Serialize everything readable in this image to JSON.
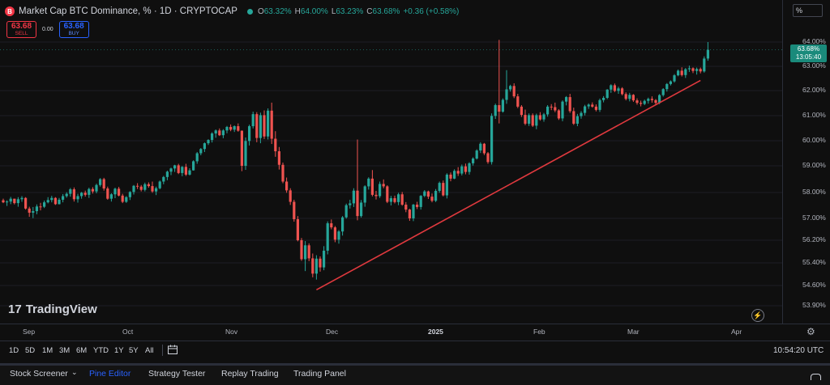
{
  "header": {
    "logo_letter": "B",
    "title": "Market Cap BTC Dominance, %",
    "interval": "1D",
    "source": "CRYPTOCAP",
    "ohlc": {
      "o_label": "O",
      "o": "63.32%",
      "h_label": "H",
      "h": "64.00%",
      "l_label": "L",
      "l": "63.23%",
      "c_label": "C",
      "c": "63.68%",
      "change": "+0.36 (+0.58%)"
    }
  },
  "trade": {
    "sell_price": "63.68",
    "sell_label": "SELL",
    "spread": "0.00",
    "buy_price": "63.68",
    "buy_label": "BUY"
  },
  "watermark": {
    "mark": "17",
    "text": "TradingView"
  },
  "scale_mode": "%",
  "price_ticks": [
    "64.00%",
    "63.00%",
    "62.00%",
    "61.00%",
    "60.00%",
    "59.00%",
    "58.00%",
    "57.00%",
    "56.20%",
    "55.40%",
    "54.60%",
    "53.90%"
  ],
  "last_price": {
    "value": "63.68%",
    "countdown": "13:05:40"
  },
  "time_labels": [
    "Sep",
    "Oct",
    "Nov",
    "Dec",
    "2025",
    "Feb",
    "Mar",
    "Apr"
  ],
  "toolbar": {
    "ranges": [
      "1D",
      "5D",
      "1M",
      "3M",
      "6M",
      "YTD",
      "1Y",
      "5Y",
      "All"
    ],
    "clock": "10:54:20 UTC"
  },
  "panels": {
    "tabs": [
      "Stock Screener",
      "Pine Editor",
      "Strategy Tester",
      "Replay Trading",
      "Trading Panel"
    ],
    "active": "Pine Editor"
  },
  "colors": {
    "up": "#26a69a",
    "down": "#ef5350",
    "trendline": "#e0393e",
    "accent": "#2962ff",
    "background": "#0f0f0f"
  },
  "chart_data": {
    "type": "candlestick",
    "symbol": "BTC.D",
    "interval": "1D",
    "ylim": [
      53.9,
      64.0
    ],
    "candles": [
      [
        57.7,
        57.76,
        57.59,
        57.62
      ],
      [
        57.62,
        57.7,
        57.48,
        57.65
      ],
      [
        57.65,
        57.83,
        57.55,
        57.76
      ],
      [
        57.76,
        57.76,
        57.54,
        57.59
      ],
      [
        57.59,
        57.82,
        57.45,
        57.74
      ],
      [
        57.74,
        57.86,
        57.64,
        57.79
      ],
      [
        57.79,
        57.82,
        57.34,
        57.38
      ],
      [
        57.38,
        57.45,
        57.06,
        57.22
      ],
      [
        57.22,
        57.44,
        57.01,
        57.28
      ],
      [
        57.28,
        57.54,
        57.16,
        57.46
      ],
      [
        57.46,
        57.6,
        57.31,
        57.45
      ],
      [
        57.45,
        57.69,
        57.4,
        57.62
      ],
      [
        57.62,
        57.82,
        57.58,
        57.71
      ],
      [
        57.71,
        57.87,
        57.62,
        57.79
      ],
      [
        57.79,
        57.82,
        57.52,
        57.55
      ],
      [
        57.55,
        57.79,
        57.54,
        57.72
      ],
      [
        57.72,
        57.94,
        57.62,
        57.86
      ],
      [
        57.86,
        58.01,
        57.8,
        57.95
      ],
      [
        57.95,
        58.17,
        57.84,
        58.12
      ],
      [
        58.12,
        58.19,
        57.65,
        57.74
      ],
      [
        57.74,
        57.95,
        57.61,
        57.86
      ],
      [
        57.86,
        58.02,
        57.76,
        57.99
      ],
      [
        57.99,
        58.07,
        57.84,
        57.91
      ],
      [
        57.91,
        58.18,
        57.79,
        58.13
      ],
      [
        58.13,
        58.2,
        57.96,
        58.04
      ],
      [
        58.04,
        58.33,
        57.97,
        58.28
      ],
      [
        58.28,
        58.54,
        58.22,
        58.5
      ],
      [
        58.5,
        58.55,
        58.07,
        58.15
      ],
      [
        58.15,
        58.22,
        57.72,
        57.76
      ],
      [
        57.76,
        57.97,
        57.65,
        57.93
      ],
      [
        57.93,
        58.18,
        57.78,
        58.14
      ],
      [
        58.14,
        58.21,
        57.85,
        57.88
      ],
      [
        57.88,
        57.95,
        57.59,
        57.64
      ],
      [
        57.64,
        57.86,
        57.6,
        57.82
      ],
      [
        57.82,
        58.05,
        57.71,
        58.02
      ],
      [
        58.02,
        58.28,
        57.92,
        58.25
      ],
      [
        58.25,
        58.35,
        58.13,
        58.22
      ],
      [
        58.22,
        58.28,
        58.04,
        58.1
      ],
      [
        58.1,
        58.37,
        58.04,
        58.31
      ],
      [
        58.31,
        58.38,
        58.18,
        58.24
      ],
      [
        58.24,
        58.41,
        57.99,
        58.04
      ],
      [
        58.04,
        58.22,
        57.9,
        58.16
      ],
      [
        58.16,
        58.45,
        58.12,
        58.41
      ],
      [
        58.41,
        58.62,
        58.31,
        58.58
      ],
      [
        58.58,
        58.82,
        58.46,
        58.78
      ],
      [
        58.78,
        58.93,
        58.65,
        58.9
      ],
      [
        58.9,
        59.04,
        58.77,
        59.02
      ],
      [
        59.02,
        59.08,
        58.69,
        58.73
      ],
      [
        58.73,
        58.99,
        58.61,
        58.96
      ],
      [
        58.96,
        59.08,
        58.62,
        58.67
      ],
      [
        58.67,
        58.91,
        58.64,
        58.83
      ],
      [
        58.83,
        59.22,
        58.82,
        59.18
      ],
      [
        59.18,
        59.55,
        59.08,
        59.5
      ],
      [
        59.5,
        59.71,
        59.42,
        59.67
      ],
      [
        59.67,
        59.93,
        59.55,
        59.9
      ],
      [
        59.9,
        60.06,
        59.83,
        60.03
      ],
      [
        60.03,
        60.34,
        59.93,
        60.29
      ],
      [
        60.29,
        60.45,
        60.12,
        60.41
      ],
      [
        60.41,
        60.49,
        60.19,
        60.22
      ],
      [
        60.22,
        60.46,
        60.1,
        60.41
      ],
      [
        60.41,
        60.59,
        60.3,
        60.55
      ],
      [
        60.55,
        60.65,
        60.38,
        60.44
      ],
      [
        60.44,
        60.61,
        60.35,
        60.58
      ],
      [
        60.58,
        60.69,
        60.36,
        60.4
      ],
      [
        60.4,
        60.41,
        58.8,
        59.0
      ],
      [
        59.0,
        60.13,
        58.85,
        59.99
      ],
      [
        59.99,
        60.64,
        59.81,
        60.58
      ],
      [
        60.58,
        61.16,
        60.49,
        61.06
      ],
      [
        61.06,
        61.14,
        59.94,
        60.11
      ],
      [
        60.11,
        61.12,
        59.9,
        61.02
      ],
      [
        61.02,
        61.21,
        60.07,
        60.17
      ],
      [
        60.17,
        61.29,
        60.05,
        61.2
      ],
      [
        61.2,
        61.52,
        59.87,
        60.08
      ],
      [
        60.08,
        60.38,
        59.36,
        59.58
      ],
      [
        59.58,
        59.75,
        58.86,
        59.04
      ],
      [
        59.04,
        59.13,
        58.35,
        58.41
      ],
      [
        58.41,
        58.56,
        57.99,
        58.08
      ],
      [
        58.08,
        58.16,
        57.52,
        57.64
      ],
      [
        57.64,
        57.72,
        56.88,
        56.97
      ],
      [
        56.97,
        57.09,
        56.16,
        56.2
      ],
      [
        56.2,
        56.28,
        55.47,
        55.53
      ],
      [
        55.53,
        56.17,
        55.11,
        56.02
      ],
      [
        56.02,
        56.09,
        55.46,
        55.56
      ],
      [
        55.56,
        55.73,
        54.89,
        55.02
      ],
      [
        55.02,
        55.67,
        54.81,
        55.55
      ],
      [
        55.55,
        55.63,
        55.09,
        55.24
      ],
      [
        55.24,
        55.99,
        55.14,
        55.83
      ],
      [
        55.83,
        56.89,
        55.7,
        56.82
      ],
      [
        56.82,
        56.96,
        56.6,
        56.67
      ],
      [
        56.67,
        56.72,
        56.13,
        56.22
      ],
      [
        56.22,
        56.57,
        56.08,
        56.52
      ],
      [
        56.52,
        57.09,
        56.37,
        57.04
      ],
      [
        57.04,
        57.57,
        56.99,
        57.51
      ],
      [
        57.51,
        57.72,
        57.38,
        57.58
      ],
      [
        57.58,
        58.16,
        57.44,
        58.07
      ],
      [
        58.07,
        60.05,
        56.93,
        57.09
      ],
      [
        57.09,
        57.71,
        57.03,
        57.61
      ],
      [
        57.61,
        58.27,
        57.45,
        58.23
      ],
      [
        58.23,
        58.57,
        58.11,
        58.52
      ],
      [
        58.52,
        58.84,
        57.85,
        57.91
      ],
      [
        57.91,
        58.06,
        57.73,
        57.86
      ],
      [
        57.86,
        58.41,
        57.79,
        58.32
      ],
      [
        58.32,
        58.49,
        58.16,
        58.23
      ],
      [
        58.23,
        58.27,
        57.59,
        57.64
      ],
      [
        57.64,
        57.87,
        57.5,
        57.78
      ],
      [
        57.78,
        57.88,
        57.58,
        57.63
      ],
      [
        57.63,
        57.99,
        57.51,
        57.93
      ],
      [
        57.93,
        58.02,
        57.49,
        57.53
      ],
      [
        57.53,
        57.63,
        57.24,
        57.34
      ],
      [
        57.34,
        57.37,
        56.91,
        57.0
      ],
      [
        57.0,
        57.56,
        56.9,
        57.53
      ],
      [
        57.53,
        57.64,
        57.36,
        57.44
      ],
      [
        57.44,
        57.9,
        57.34,
        57.87
      ],
      [
        57.87,
        58.09,
        57.82,
        58.04
      ],
      [
        58.04,
        58.07,
        57.75,
        57.84
      ],
      [
        57.84,
        57.96,
        57.62,
        57.68
      ],
      [
        57.68,
        58.13,
        57.63,
        58.06
      ],
      [
        58.06,
        58.41,
        57.99,
        58.36
      ],
      [
        58.36,
        58.45,
        57.85,
        57.89
      ],
      [
        57.89,
        58.72,
        57.77,
        58.67
      ],
      [
        58.67,
        58.75,
        58.42,
        58.52
      ],
      [
        58.52,
        58.87,
        58.5,
        58.81
      ],
      [
        58.81,
        58.95,
        58.62,
        58.71
      ],
      [
        58.71,
        59.05,
        58.64,
        58.98
      ],
      [
        58.98,
        59.09,
        58.68,
        58.77
      ],
      [
        58.77,
        59.14,
        58.67,
        59.1
      ],
      [
        59.1,
        59.34,
        59.01,
        59.29
      ],
      [
        59.29,
        59.66,
        59.25,
        59.61
      ],
      [
        59.61,
        59.94,
        59.51,
        59.88
      ],
      [
        59.88,
        59.91,
        59.43,
        59.5
      ],
      [
        59.5,
        59.55,
        59.08,
        59.15
      ],
      [
        59.15,
        61.09,
        59.05,
        60.99
      ],
      [
        60.99,
        61.48,
        60.87,
        61.42
      ],
      [
        61.42,
        64.09,
        60.69,
        61.16
      ],
      [
        61.16,
        61.69,
        61.12,
        61.63
      ],
      [
        61.63,
        62.84,
        61.47,
        62.05
      ],
      [
        62.05,
        62.24,
        61.96,
        62.19
      ],
      [
        62.19,
        62.3,
        61.7,
        61.77
      ],
      [
        61.77,
        61.87,
        61.3,
        61.36
      ],
      [
        61.36,
        61.42,
        60.95,
        61.03
      ],
      [
        61.03,
        61.24,
        60.62,
        60.68
      ],
      [
        60.68,
        61.09,
        60.59,
        61.02
      ],
      [
        61.02,
        61.09,
        60.55,
        60.6
      ],
      [
        60.6,
        61.08,
        60.46,
        61.02
      ],
      [
        61.02,
        61.14,
        60.8,
        60.85
      ],
      [
        60.85,
        61.11,
        60.76,
        61.05
      ],
      [
        61.05,
        61.42,
        60.96,
        61.36
      ],
      [
        61.36,
        61.46,
        61.22,
        61.34
      ],
      [
        61.34,
        61.52,
        61.14,
        61.21
      ],
      [
        61.21,
        61.26,
        60.83,
        60.89
      ],
      [
        60.89,
        61.61,
        60.78,
        61.56
      ],
      [
        61.56,
        61.78,
        61.41,
        61.74
      ],
      [
        61.74,
        61.87,
        61.11,
        61.18
      ],
      [
        61.18,
        61.32,
        60.63,
        60.68
      ],
      [
        60.68,
        61.07,
        60.58,
        60.98
      ],
      [
        60.98,
        61.18,
        60.88,
        61.11
      ],
      [
        61.11,
        61.43,
        61.01,
        61.37
      ],
      [
        61.37,
        61.49,
        61.27,
        61.44
      ],
      [
        61.44,
        61.53,
        61.32,
        61.36
      ],
      [
        61.36,
        61.45,
        61.17,
        61.23
      ],
      [
        61.23,
        61.68,
        61.15,
        61.62
      ],
      [
        61.62,
        61.78,
        61.53,
        61.71
      ],
      [
        61.71,
        62.06,
        61.66,
        62.04
      ],
      [
        62.04,
        62.26,
        61.91,
        62.22
      ],
      [
        62.22,
        62.29,
        61.94,
        61.99
      ],
      [
        61.99,
        62.16,
        61.87,
        62.09
      ],
      [
        62.09,
        62.14,
        61.81,
        61.86
      ],
      [
        61.86,
        61.93,
        61.61,
        61.67
      ],
      [
        61.67,
        61.91,
        61.57,
        61.83
      ],
      [
        61.83,
        61.86,
        61.55,
        61.61
      ],
      [
        61.61,
        61.69,
        61.44,
        61.51
      ],
      [
        61.51,
        61.6,
        61.37,
        61.47
      ],
      [
        61.47,
        61.64,
        61.42,
        61.59
      ],
      [
        61.59,
        61.72,
        61.48,
        61.67
      ],
      [
        61.67,
        61.77,
        61.52,
        61.62
      ],
      [
        61.62,
        61.66,
        61.44,
        61.51
      ],
      [
        61.51,
        61.86,
        61.46,
        61.82
      ],
      [
        61.82,
        62.1,
        61.76,
        62.06
      ],
      [
        62.06,
        62.31,
        61.96,
        62.27
      ],
      [
        62.27,
        62.42,
        62.21,
        62.38
      ],
      [
        62.38,
        62.68,
        62.33,
        62.63
      ],
      [
        62.63,
        62.87,
        62.59,
        62.82
      ],
      [
        62.82,
        62.96,
        62.58,
        62.64
      ],
      [
        62.64,
        62.93,
        62.52,
        62.88
      ],
      [
        62.88,
        63.03,
        62.77,
        62.92
      ],
      [
        62.92,
        62.96,
        62.72,
        62.81
      ],
      [
        62.81,
        62.95,
        62.66,
        62.89
      ],
      [
        62.89,
        62.95,
        62.71,
        62.79
      ],
      [
        62.79,
        63.41,
        62.74,
        63.32
      ],
      [
        63.32,
        64.0,
        63.23,
        63.68
      ]
    ],
    "trendline": {
      "points": [
        [
          84,
          54.45
        ],
        [
          187,
          62.42
        ]
      ],
      "unit": "candle-index, percent"
    }
  }
}
